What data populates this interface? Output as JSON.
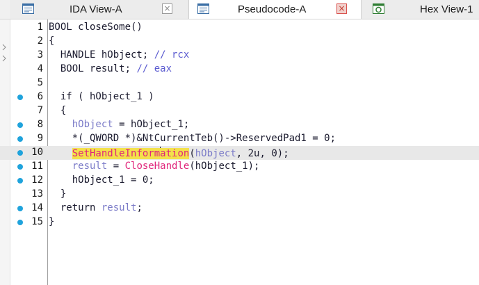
{
  "tabs": [
    {
      "label": "IDA View-A",
      "icon": "grid-view-icon",
      "active": false,
      "close_icon": "close-icon"
    },
    {
      "label": "Pseudocode-A",
      "icon": "grid-view-icon",
      "active": true,
      "close_icon": "close-icon"
    },
    {
      "label": "Hex View-1",
      "icon": "hex-view-icon",
      "active": false
    }
  ],
  "code_lines": [
    {
      "number": "1",
      "dot": false,
      "parts": [
        [
          "BOOL closeSome()",
          "plain"
        ]
      ]
    },
    {
      "number": "2",
      "dot": false,
      "parts": [
        [
          "{",
          "plain"
        ]
      ]
    },
    {
      "number": "3",
      "dot": false,
      "parts": [
        [
          "  HANDLE hObject; ",
          "plain"
        ],
        [
          "// rcx",
          "comment"
        ]
      ]
    },
    {
      "number": "4",
      "dot": false,
      "parts": [
        [
          "  BOOL result; ",
          "plain"
        ],
        [
          "// eax",
          "comment"
        ]
      ]
    },
    {
      "number": "5",
      "dot": false,
      "parts": [
        [
          "",
          "plain"
        ]
      ]
    },
    {
      "number": "6",
      "dot": true,
      "parts": [
        [
          "  if ( hObject_1 )",
          "plain"
        ]
      ]
    },
    {
      "number": "7",
      "dot": false,
      "parts": [
        [
          "  {",
          "plain"
        ]
      ]
    },
    {
      "number": "8",
      "dot": true,
      "parts": [
        [
          "    ",
          "plain"
        ],
        [
          "hObject",
          "var"
        ],
        [
          " = hObject_1;",
          "plain"
        ]
      ]
    },
    {
      "number": "9",
      "dot": true,
      "parts": [
        [
          "    *(_QWORD *)&NtCurrentTeb()->ReservedPad1 = 0;",
          "plain"
        ]
      ]
    },
    {
      "number": "10",
      "dot": true,
      "current": true,
      "parts": [
        [
          "    ",
          "plain"
        ],
        [
          "SetHandleInform",
          "func-hl"
        ],
        [
          "",
          "caret"
        ],
        [
          "ation",
          "func-hl"
        ],
        [
          "(",
          "plain"
        ],
        [
          "hObject",
          "var"
        ],
        [
          ", 2u, 0);",
          "plain"
        ]
      ]
    },
    {
      "number": "11",
      "dot": true,
      "parts": [
        [
          "    ",
          "plain"
        ],
        [
          "result",
          "var"
        ],
        [
          " = ",
          "plain"
        ],
        [
          "CloseHandle",
          "func"
        ],
        [
          "(hObject_1);",
          "plain"
        ]
      ]
    },
    {
      "number": "12",
      "dot": true,
      "parts": [
        [
          "    hObject_1 = 0;",
          "plain"
        ]
      ]
    },
    {
      "number": "13",
      "dot": false,
      "parts": [
        [
          "  }",
          "plain"
        ]
      ]
    },
    {
      "number": "14",
      "dot": true,
      "parts": [
        [
          "  return ",
          "plain"
        ],
        [
          "result",
          "var"
        ],
        [
          ";",
          "plain"
        ]
      ]
    },
    {
      "number": "15",
      "dot": true,
      "parts": [
        [
          "}",
          "plain"
        ]
      ]
    }
  ],
  "colors": {
    "dot": "#1fa3dc",
    "function": "#e0247a",
    "variable": "#7b7bc8",
    "comment": "#5a5ad0",
    "highlight": "#f3e14b",
    "current_line": "#e8e8e8"
  }
}
